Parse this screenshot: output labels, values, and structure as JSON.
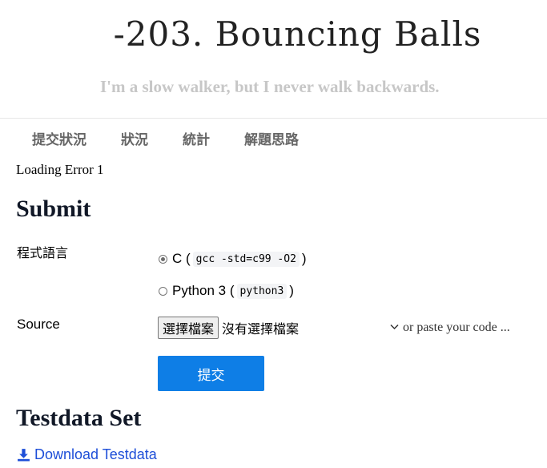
{
  "header": {
    "title": "-203. Bouncing Balls",
    "tagline": "I'm a slow walker, but I never walk backwards."
  },
  "nav": {
    "items": [
      "提交狀況",
      "狀況",
      "統計",
      "解題思路"
    ]
  },
  "status": {
    "loading_error": "Loading Error 1"
  },
  "submit": {
    "heading": "Submit",
    "language_label": "程式語言",
    "languages": [
      {
        "name": "C",
        "command": "gcc -std=c99 -O2",
        "checked": true
      },
      {
        "name": "Python 3",
        "command": "python3",
        "checked": false
      }
    ],
    "source_label": "Source",
    "file_button": "選擇檔案",
    "file_status": "沒有選擇檔案",
    "paste_toggle": "or paste your code ...",
    "submit_button": "提交",
    "submit_color": "#0e7ee6"
  },
  "testdata": {
    "heading": "Testdata Set",
    "download_label": "Download Testdata",
    "link_color": "#1d4ed8"
  }
}
